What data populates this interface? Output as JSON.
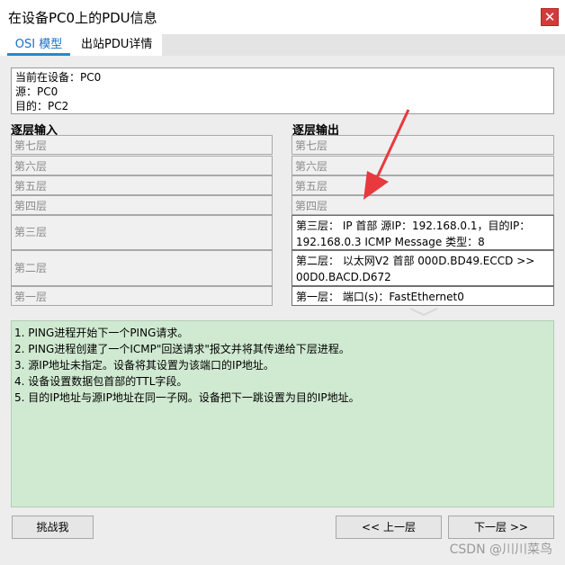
{
  "window": {
    "title": "在设备PC0上的PDU信息",
    "close_label": "✕"
  },
  "tabs": [
    {
      "label": "OSI 模型"
    },
    {
      "label": "出站PDU详情"
    }
  ],
  "device": {
    "current": "当前在设备：PC0",
    "source": "源：PC0",
    "destination": "目的：PC2"
  },
  "in_layers": {
    "header": "逐层输入",
    "items": [
      "第七层",
      "第六层",
      "第五层",
      "第四层",
      "第三层",
      "第二层",
      "第一层"
    ]
  },
  "out_layers": {
    "header": "逐层输出",
    "items": [
      "第七层",
      "第六层",
      "第五层",
      "第四层",
      "第三层： IP 首部 源IP：192.168.0.1，目的IP：192.168.0.3 ICMP Message 类型：8",
      "第二层： 以太网V2 首部 000D.BD49.ECCD >> 00D0.BACD.D672",
      "第一层： 端口(s)：FastEthernet0"
    ]
  },
  "description": [
    "1. PING进程开始下一个PING请求。",
    "2. PING进程创建了一个ICMP\"回送请求\"报文并将其传递给下层进程。",
    "3. 源IP地址未指定。设备将其设置为该端口的IP地址。",
    "4. 设备设置数据包首部的TTL字段。",
    "5. 目的IP地址与源IP地址在同一子网。设备把下一跳设置为目的IP地址。"
  ],
  "buttons": {
    "challenge": "挑战我",
    "prev": "<< 上一层",
    "next": "下一层 >>"
  },
  "watermark": "CSDN @川川菜鸟",
  "colors": {
    "annotation_arrow": "#e8393f",
    "desc_bg": "#d0ead1",
    "tab_accent": "#1e8bd6"
  }
}
